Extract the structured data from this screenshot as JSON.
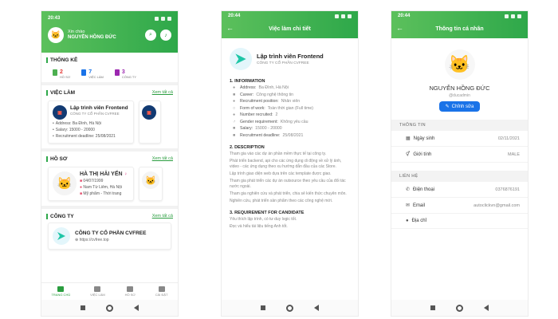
{
  "phone1": {
    "status": {
      "time": "20:43"
    },
    "header": {
      "greeting": "Xin chào",
      "name": "NGUYỄN HỒNG ĐỨC",
      "search_icon": "search-icon",
      "bell_icon": "bell-icon"
    },
    "stats": {
      "title": "THỐNG KÊ",
      "items": [
        {
          "value": "2",
          "label": "HỒ SƠ",
          "color": "#4caf50"
        },
        {
          "value": "7",
          "label": "VIỆC LÀM",
          "color": "#1a73e8"
        },
        {
          "value": "3",
          "label": "CÔNG TY",
          "color": "#9c27b0"
        }
      ]
    },
    "jobs": {
      "title": "VIỆC LÀM",
      "more": "Xem tất cả",
      "card": {
        "title": "Lập trình viên Frontend",
        "company": "CÔNG TY CỔ PHẦN CVFREE",
        "address": "Address:  Ba Đình, Hà Nội",
        "salary": "Salary:  15000 - 20000",
        "deadline": "Recruitment deadline:  25/08/2021"
      }
    },
    "profiles": {
      "title": "HỒ SƠ",
      "more": "Xem tất cả",
      "card": {
        "name": "HÀ THỊ HẢI YẾN",
        "dob": "04/07/1999",
        "location": "Nam Từ Liêm, Hà Nội",
        "field": "Mỹ phẩm - Thời trang"
      }
    },
    "companies": {
      "title": "CÔNG TY",
      "more": "Xem tất cả",
      "card": {
        "name": "CÔNG TY CỔ PHẦN CVFREE",
        "url": "https://cvfree.top"
      }
    },
    "tabs": [
      {
        "label": "TRANG CHỦ",
        "icon": "home-icon",
        "active": true
      },
      {
        "label": "VIỆC LÀM",
        "icon": "briefcase-icon",
        "active": false
      },
      {
        "label": "HỒ SƠ",
        "icon": "profile-icon",
        "active": false
      },
      {
        "label": "CÀI ĐẶT",
        "icon": "settings-icon",
        "active": false
      }
    ]
  },
  "phone2": {
    "status": {
      "time": "20:44"
    },
    "header": {
      "title": "Việc làm chi tiết"
    },
    "job": {
      "title": "Lập trình viên Frontend",
      "company": "CÔNG TY CỔ PHẦN CVFREE"
    },
    "info_title": "1. INFORMATION",
    "info": [
      {
        "icon": "location-icon",
        "key": "Address:",
        "value": "Ba Đình, Hà Nội"
      },
      {
        "icon": "briefcase-icon",
        "key": "Career:",
        "value": "Công nghệ thông tin"
      },
      {
        "icon": "user-icon",
        "key": "Recruitment position:",
        "value": "Nhân viên"
      },
      {
        "icon": "clock-icon",
        "key": "Form of work:",
        "value": "Toàn thời gian (Full time)"
      },
      {
        "icon": "users-icon",
        "key": "Number recruited:",
        "value": "2"
      },
      {
        "icon": "gender-icon",
        "key": "Gender requirement:",
        "value": "Không yêu cầu"
      },
      {
        "icon": "money-icon",
        "key": "Salary:",
        "value": "15000 - 20000"
      },
      {
        "icon": "calendar-icon",
        "key": "Recruitment deadline:",
        "value": "25/08/2021"
      }
    ],
    "desc_title": "2. DESCRIPTION",
    "desc": [
      "Tham gia vào các dự án phần mềm thực tế tại công ty.",
      "Phát triển backend, api cho các ứng dụng di động về xử lý ảnh, video - các ứng dụng theo xu hướng dẫn đầu của các Store.",
      "Lập trình giao diện web dựa trên các template được giao.",
      "Tham gia phát triển các dự án outsource theo yêu cầu của đối tác nước ngoài.",
      "Tham gia nghiên cứu và phát triển, chia sẻ kiến thức chuyên môn.",
      "Nghiên cứu, phát triển sản phẩm theo các công nghệ mới."
    ],
    "req_title": "3. REQUIREMENT FOR CANDIDATE",
    "req": [
      "Yêu thích lập trình, có tư duy logic tốt.",
      "Đọc và hiểu tài liệu tiếng Anh tốt."
    ]
  },
  "phone3": {
    "status": {
      "time": "20:44"
    },
    "header": {
      "title": "Thông tin cá nhân"
    },
    "name": "NGUYỄN HỒNG ĐỨC",
    "username": "@ducadmin",
    "edit_label": "Chỉnh sửa",
    "info_title": "THÔNG TIN",
    "info": [
      {
        "icon": "calendar-icon",
        "label": "Ngày sinh",
        "value": "02/11/2021"
      },
      {
        "icon": "gender-icon",
        "label": "Giới tính",
        "value": "MALE"
      }
    ],
    "contact_title": "LIÊN HỆ",
    "contact": [
      {
        "icon": "phone-icon",
        "label": "Điện thoại",
        "value": "0376876191"
      },
      {
        "icon": "mail-icon",
        "label": "Email",
        "value": "autoclickvn@gmail.com"
      },
      {
        "icon": "location-icon",
        "label": "Địa chỉ",
        "value": ""
      }
    ]
  }
}
